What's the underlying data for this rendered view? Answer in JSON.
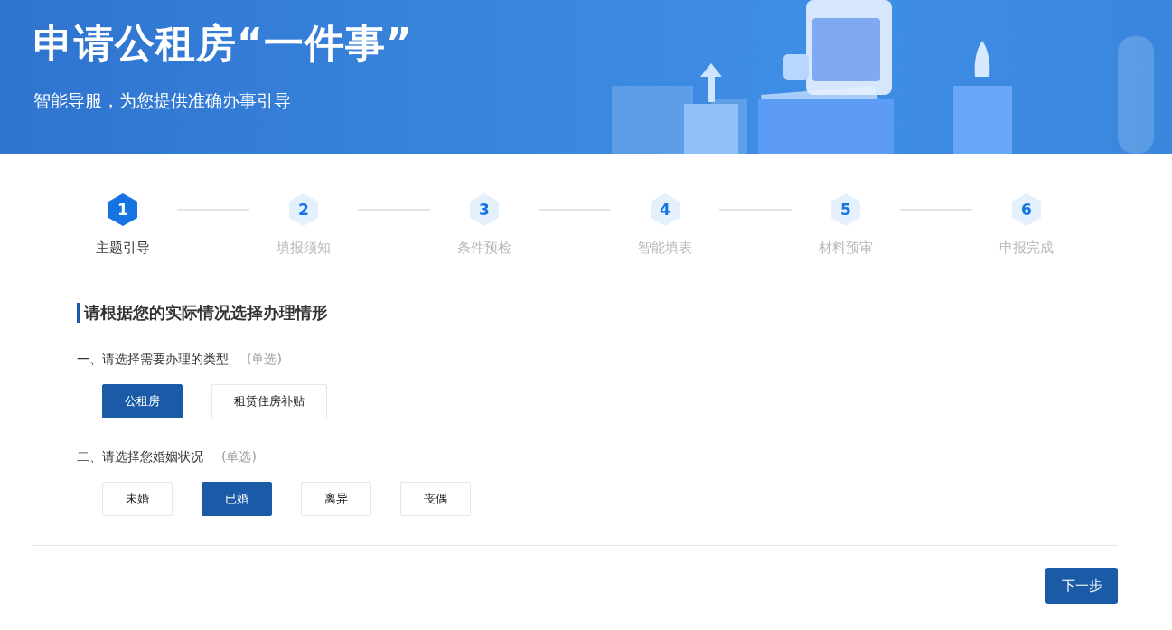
{
  "banner": {
    "title": "申请公租房“一件事”",
    "subtitle": "智能导服，为您提供准确办事引导"
  },
  "steps": [
    {
      "number": "1",
      "label": "主题引导",
      "selected": true
    },
    {
      "number": "2",
      "label": "填报须知",
      "selected": false
    },
    {
      "number": "3",
      "label": "条件预检",
      "selected": false
    },
    {
      "number": "4",
      "label": "智能填表",
      "selected": false
    },
    {
      "number": "5",
      "label": "材料预审",
      "selected": false
    },
    {
      "number": "6",
      "label": "申报完成",
      "selected": false
    }
  ],
  "section_title": "请根据您的实际情况选择办理情形",
  "questions": [
    {
      "label": "一、请选择需要办理的类型",
      "hint": "(单选)",
      "options": [
        {
          "label": "公租房",
          "selected": true
        },
        {
          "label": "租赁住房补贴",
          "selected": false
        }
      ]
    },
    {
      "label": "二、请选择您婚姻状况",
      "hint": "(单选)",
      "options": [
        {
          "label": "未婚",
          "selected": false
        },
        {
          "label": "已婚",
          "selected": true
        },
        {
          "label": "离异",
          "selected": false
        },
        {
          "label": "丧偶",
          "selected": false
        }
      ]
    }
  ],
  "next_button": "下一步"
}
